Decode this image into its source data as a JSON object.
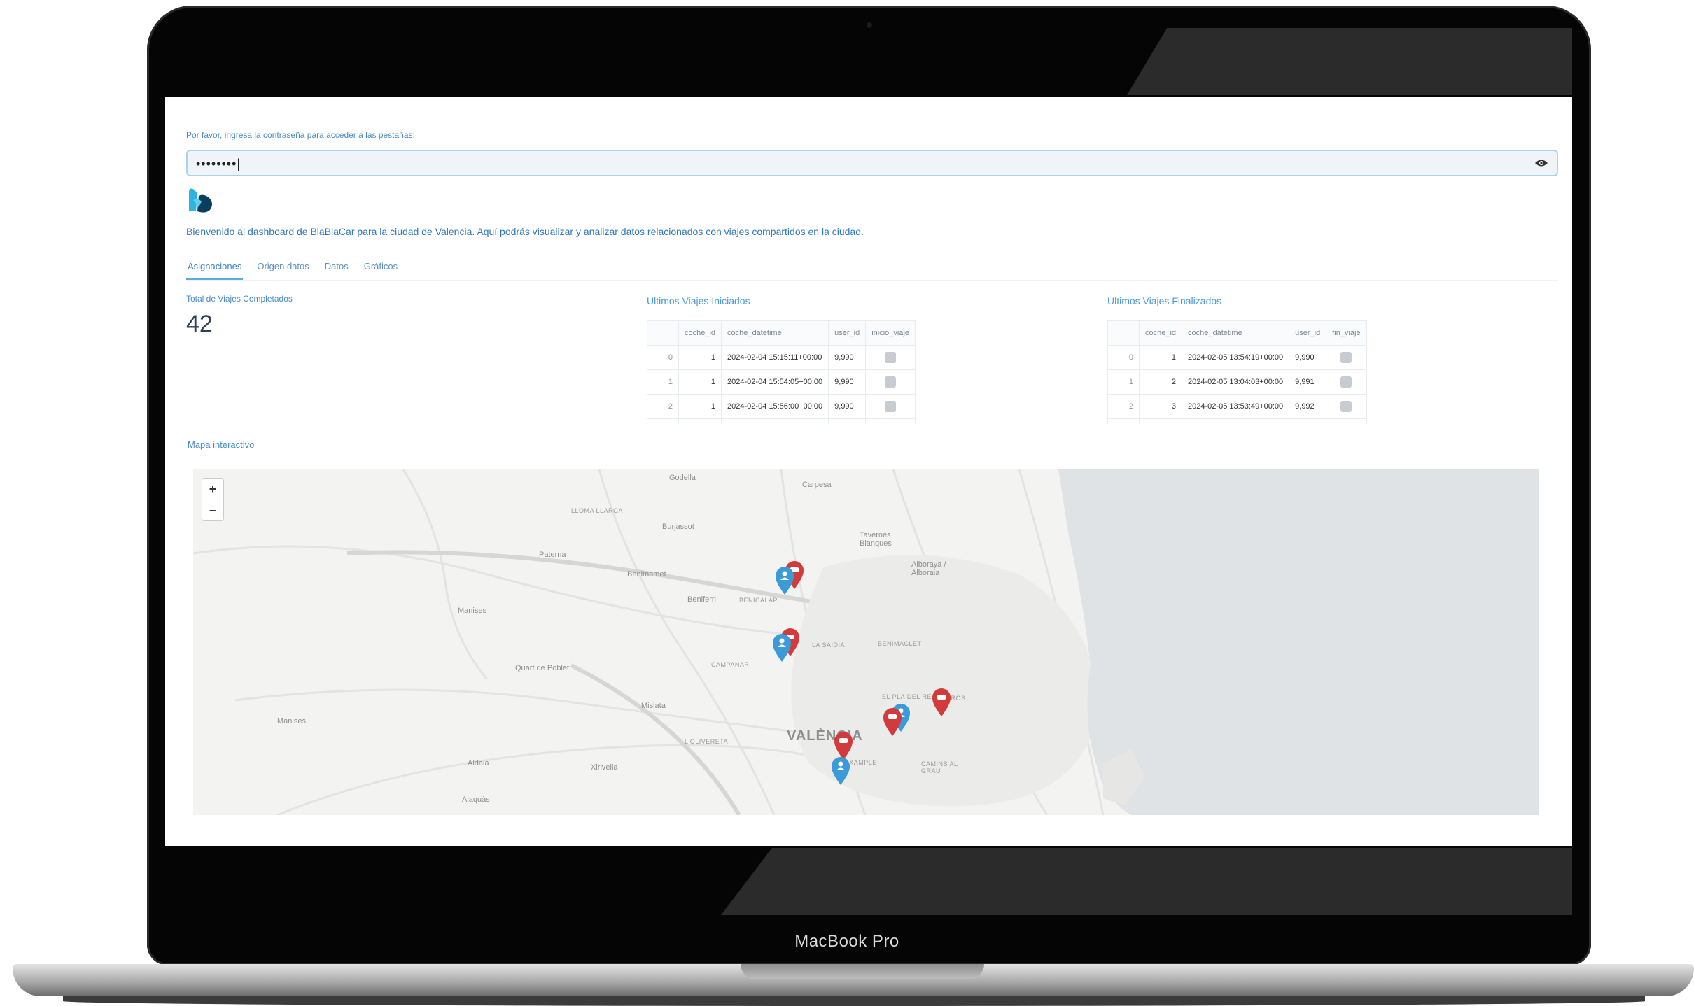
{
  "device": {
    "model_label": "MacBook Pro"
  },
  "password": {
    "label": "Por favor, ingresa la contraseña para acceder a las pestañas:",
    "value": "••••••••|"
  },
  "welcome_text": "Bienvenido al dashboard de BlaBlaCar para la ciudad de Valencia. Aquí podrás visualizar y analizar datos relacionados con viajes compartidos en la ciudad.",
  "tabs": [
    {
      "label": "Asignaciones",
      "active": true
    },
    {
      "label": "Origen datos",
      "active": false
    },
    {
      "label": "Datos",
      "active": false
    },
    {
      "label": "Gráficos",
      "active": false
    }
  ],
  "metric": {
    "label": "Total de Viajes Completados",
    "value": "42"
  },
  "started_trips": {
    "title": "Ultimos Viajes Iniciados",
    "columns": [
      "",
      "coche_id",
      "coche_datetime",
      "user_id",
      "inicio_viaje"
    ],
    "rows": [
      [
        "0",
        "1",
        "2024-02-04 15:15:11+00:00",
        "9,990"
      ],
      [
        "1",
        "1",
        "2024-02-04 15:54:05+00:00",
        "9,990"
      ],
      [
        "2",
        "1",
        "2024-02-04 15:56:00+00:00",
        "9,990"
      ]
    ]
  },
  "finished_trips": {
    "title": "Ultimos Viajes Finalizados",
    "columns": [
      "",
      "coche_id",
      "coche_datetime",
      "user_id",
      "fin_viaje"
    ],
    "rows": [
      [
        "0",
        "1",
        "2024-02-05 13:54:19+00:00",
        "9,990"
      ],
      [
        "1",
        "2",
        "2024-02-05 13:04:03+00:00",
        "9,991"
      ],
      [
        "2",
        "3",
        "2024-02-05 13:53:49+00:00",
        "9,992"
      ]
    ]
  },
  "map": {
    "label": "Mapa interactivo",
    "zoom_in": "+",
    "zoom_out": "−",
    "places": {
      "godella": "Godella",
      "carpesa": "Carpesa",
      "lloma_llarga": "LLOMA LLARGA",
      "burjassot": "Burjassot",
      "tavernes": "Tavernes Blanques",
      "paterna": "Paterna",
      "benimamet": "Benimamet",
      "alboraya": "Alboraya / Alboraia",
      "beniferri": "Beniferri",
      "benicalap": "BENICALAP",
      "manises": "Manises",
      "la_saidia": "LA SAIDIA",
      "benimaclet": "BENIMACLET",
      "quart": "Quart de Poblet",
      "campanar": "CAMPANAR",
      "mislata": "Mislata",
      "el_pla": "EL PLA DEL REAL",
      "algiros": "ALGIRÓS",
      "valencia": "VALÈNCIA",
      "lolivereta": "L'OLIVERETA",
      "xirivella": "Xirivella",
      "aldaia": "Aldaia",
      "eixample": "L'EIXAMPLE",
      "camins": "CAMINS AL GRAU",
      "alaquas": "Alaquàs",
      "manises_road": "Manises"
    },
    "colors": {
      "user_marker": "#3a9bd8",
      "car_marker": "#d13b3b",
      "sea": "#dfe3e6"
    }
  }
}
